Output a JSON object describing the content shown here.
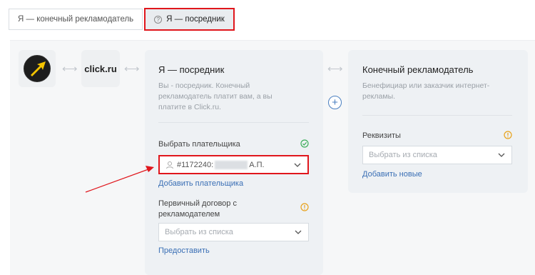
{
  "tabs": [
    {
      "label": "Я — конечный рекламодатель"
    },
    {
      "label": "Я — посредник"
    }
  ],
  "brand_partner": "click.ru",
  "intermediary_card": {
    "title": "Я — посредник",
    "description": "Вы - посредник. Конечный рекламодатель платит вам, а вы платите в Click.ru.",
    "payer_label": "Выбрать плательщика",
    "payer_value_prefix": "#1172240:",
    "payer_value_suffix": "А.П.",
    "add_payer_link": "Добавить плательщика",
    "contract_label": "Первичный договор с рекламодателем",
    "contract_placeholder": "Выбрать из списка",
    "provide_link": "Предоставить"
  },
  "advertiser_card": {
    "title": "Конечный рекламодатель",
    "description": "Бенефициар или заказчик интернет-рекламы.",
    "requisites_label": "Реквизиты",
    "requisites_placeholder": "Выбрать из списка",
    "add_new_link": "Добавить новые"
  },
  "colors": {
    "highlight": "#e0161c",
    "link": "#3a6fb5",
    "success": "#3cae5a",
    "warning": "#e8a21a",
    "logo_yellow": "#f5c400"
  }
}
